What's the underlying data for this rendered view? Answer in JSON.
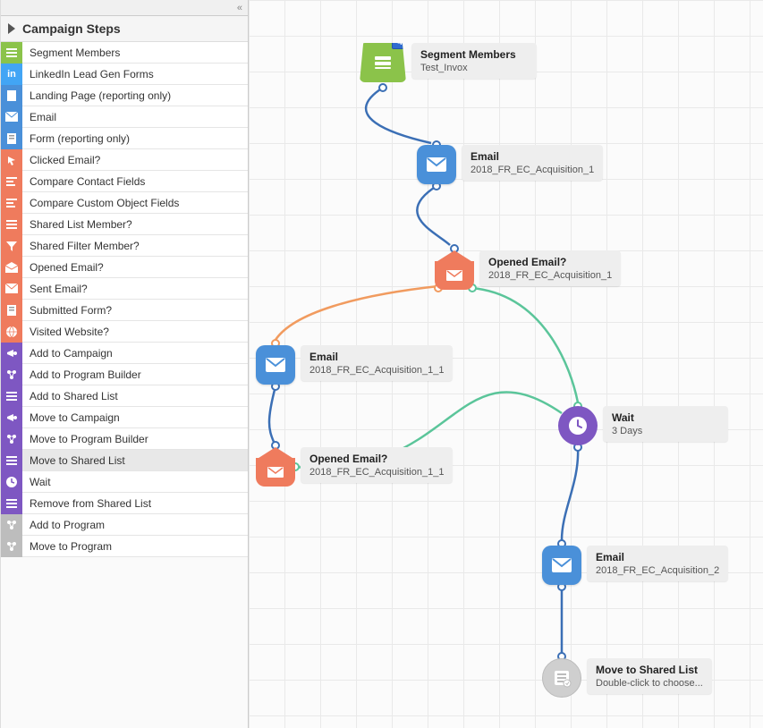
{
  "sidebar": {
    "title": "Campaign Steps",
    "collapse_glyph": "«",
    "items": [
      {
        "label": "Segment Members",
        "color": "c-green",
        "icon": "list"
      },
      {
        "label": "LinkedIn Lead Gen Forms",
        "color": "c-lblue",
        "icon": "in"
      },
      {
        "label": "Landing Page (reporting only)",
        "color": "c-blue",
        "icon": "page"
      },
      {
        "label": "Email",
        "color": "c-blue",
        "icon": "mail"
      },
      {
        "label": "Form (reporting only)",
        "color": "c-blue",
        "icon": "form"
      },
      {
        "label": "Clicked Email?",
        "color": "c-coral",
        "icon": "click"
      },
      {
        "label": "Compare Contact Fields",
        "color": "c-coral",
        "icon": "compare"
      },
      {
        "label": "Compare Custom Object Fields",
        "color": "c-coral",
        "icon": "compare"
      },
      {
        "label": "Shared List Member?",
        "color": "c-coral",
        "icon": "list"
      },
      {
        "label": "Shared Filter Member?",
        "color": "c-coral",
        "icon": "filter"
      },
      {
        "label": "Opened Email?",
        "color": "c-coral",
        "icon": "openmail"
      },
      {
        "label": "Sent Email?",
        "color": "c-coral",
        "icon": "sentmail"
      },
      {
        "label": "Submitted Form?",
        "color": "c-coral",
        "icon": "form"
      },
      {
        "label": "Visited Website?",
        "color": "c-coral",
        "icon": "globe"
      },
      {
        "label": "Add to Campaign",
        "color": "c-purple",
        "icon": "campaign"
      },
      {
        "label": "Add to Program Builder",
        "color": "c-purple",
        "icon": "program"
      },
      {
        "label": "Add to Shared List",
        "color": "c-purple",
        "icon": "list"
      },
      {
        "label": "Move to Campaign",
        "color": "c-purple",
        "icon": "campaign"
      },
      {
        "label": "Move to Program Builder",
        "color": "c-purple",
        "icon": "program"
      },
      {
        "label": "Move to Shared List",
        "color": "c-purple",
        "icon": "list",
        "selected": true
      },
      {
        "label": "Wait",
        "color": "c-purple",
        "icon": "clock"
      },
      {
        "label": "Remove from Shared List",
        "color": "c-purple",
        "icon": "list"
      },
      {
        "label": "Add to Program",
        "color": "c-gray",
        "icon": "program"
      },
      {
        "label": "Move to Program",
        "color": "c-gray",
        "icon": "program"
      }
    ]
  },
  "canvas": {
    "nodes": {
      "segment": {
        "title": "Segment Members",
        "sub": "Test_Invox",
        "badge": "4"
      },
      "email1": {
        "title": "Email",
        "sub": "2018_FR_EC_Acquisition_1"
      },
      "opened1": {
        "title": "Opened Email?",
        "sub": "2018_FR_EC_Acquisition_1"
      },
      "email11": {
        "title": "Email",
        "sub": "2018_FR_EC_Acquisition_1_1"
      },
      "opened11": {
        "title": "Opened Email?",
        "sub": "2018_FR_EC_Acquisition_1_1"
      },
      "wait": {
        "title": "Wait",
        "sub": "3 Days"
      },
      "email2": {
        "title": "Email",
        "sub": "2018_FR_EC_Acquisition_2"
      },
      "moveto": {
        "title": "Move to Shared List",
        "sub": "Double-click to choose..."
      }
    }
  },
  "colors": {
    "flow_blue": "#3b6fb5",
    "flow_green": "#5bc59a",
    "flow_orange": "#f19b5f"
  }
}
